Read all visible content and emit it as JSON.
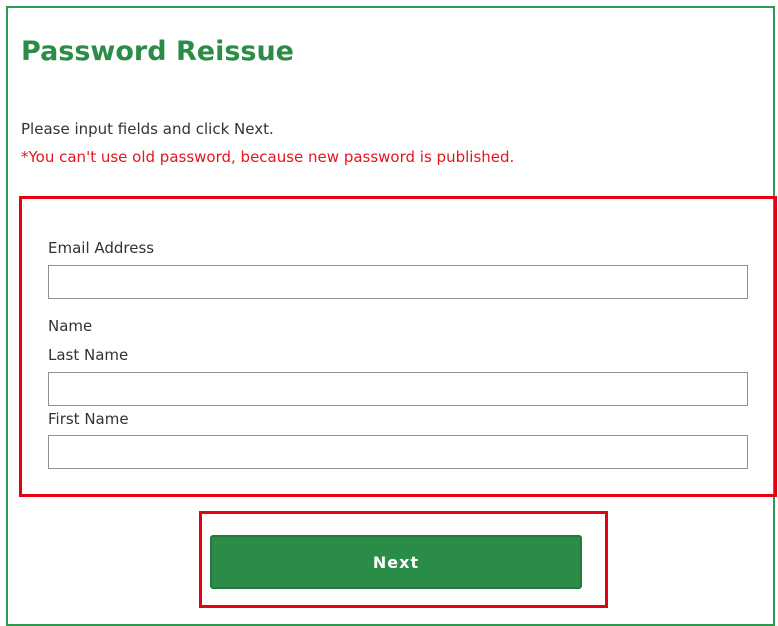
{
  "page": {
    "title": "Password Reissue",
    "intro": "Please input fields and click Next.",
    "warning": "*You can't use old password, because new password is published."
  },
  "form": {
    "email_label": "Email Address",
    "email_value": "",
    "name_label": "Name",
    "last_name_label": "Last Name",
    "last_name_value": "",
    "first_name_label": "First Name",
    "first_name_value": ""
  },
  "actions": {
    "next_label": "Next"
  },
  "colors": {
    "accent_green": "#2a8c47",
    "highlight_red": "#e50012",
    "warning_red": "#e8141b"
  }
}
